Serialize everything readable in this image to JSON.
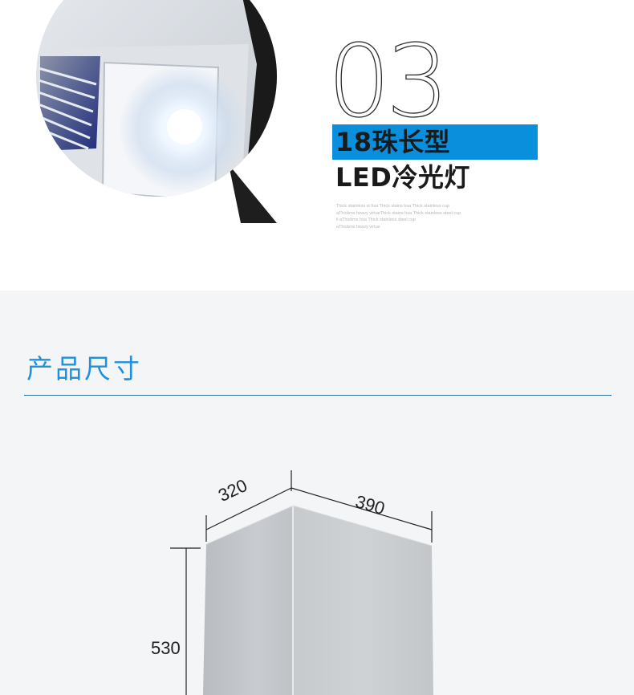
{
  "feature": {
    "number": "03",
    "title_line1": "18珠长型",
    "title_line2": "LED冷光灯",
    "fineprint": [
      "Thick stainless st hsa Thick stains hsa Thick stainless cup",
      "aThickms heavy virtueThick stains hsa Thick stainless steel cup",
      "il aThickms hsa Thick stainless steel cup",
      "aThickms heavy virtue"
    ],
    "accent_color": "#0a8fdc",
    "image_icon": "light-panel-closeup-icon"
  },
  "dimensions": {
    "section_title": "产品尺寸",
    "accent_color": "#1e90e0",
    "width": "320",
    "depth": "390",
    "height": "530",
    "drawing_icon": "product-box-icon"
  }
}
